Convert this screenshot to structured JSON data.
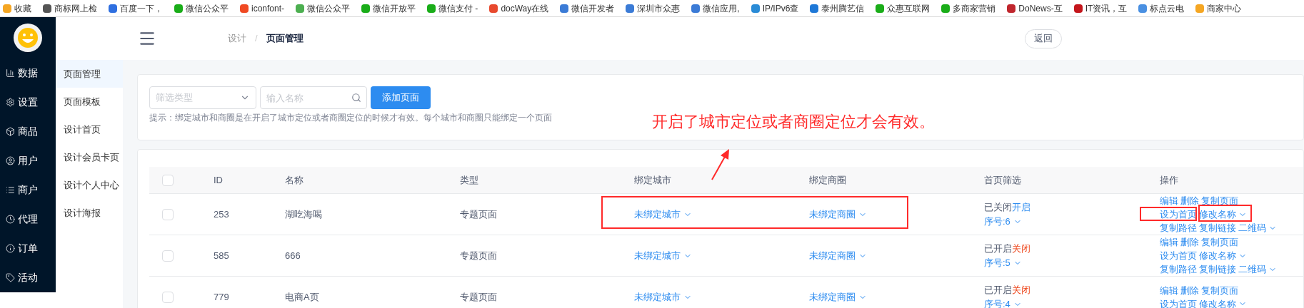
{
  "bookmarks": [
    {
      "label": "收藏",
      "color": "#f5a623"
    },
    {
      "label": "商标网上检",
      "color": "#555555"
    },
    {
      "label": "百度一下，",
      "color": "#2f6fe0"
    },
    {
      "label": "微信公众平",
      "color": "#1aad19"
    },
    {
      "label": "iconfont-",
      "color": "#f04a23"
    },
    {
      "label": "微信公众平",
      "color": "#4caf50"
    },
    {
      "label": "微信开放平",
      "color": "#1aad19"
    },
    {
      "label": "微信支付 -",
      "color": "#1aad19"
    },
    {
      "label": "docWay在线",
      "color": "#e8492e"
    },
    {
      "label": "微信开发者",
      "color": "#3b7bd6"
    },
    {
      "label": "深圳市众惠",
      "color": "#3b7bd6"
    },
    {
      "label": "微信应用,",
      "color": "#3b7bd6"
    },
    {
      "label": "IP/IPv6查",
      "color": "#2a8bd6"
    },
    {
      "label": "泰州腾艺信",
      "color": "#1e78d7"
    },
    {
      "label": "众惠互联网",
      "color": "#1aad19"
    },
    {
      "label": "多商家营销",
      "color": "#1aad19"
    },
    {
      "label": "DoNews-互",
      "color": "#c0262d"
    },
    {
      "label": "IT资讯，互",
      "color": "#c4161c"
    },
    {
      "label": "标点云电",
      "color": "#4a90e2"
    },
    {
      "label": "商家中心",
      "color": "#f5a623"
    }
  ],
  "nav": [
    {
      "label": "数据",
      "selected": false
    },
    {
      "label": "设置",
      "selected": false
    },
    {
      "label": "商品",
      "selected": false
    },
    {
      "label": "用户",
      "selected": false
    },
    {
      "label": "商户",
      "selected": false
    },
    {
      "label": "代理",
      "selected": false
    },
    {
      "label": "订单",
      "selected": false
    },
    {
      "label": "活动",
      "selected": false
    }
  ],
  "submenu": [
    {
      "label": "页面管理",
      "selected": true
    },
    {
      "label": "页面模板",
      "selected": false
    },
    {
      "label": "设计首页",
      "selected": false
    },
    {
      "label": "设计会员卡页",
      "selected": false
    },
    {
      "label": "设计个人中心",
      "selected": false
    },
    {
      "label": "设计海报",
      "selected": false
    }
  ],
  "breadcrumb": [
    "设计",
    "页面管理"
  ],
  "breadcrumb_separator": "/",
  "back_button": "返回",
  "filter": {
    "type_placeholder": "筛选类型",
    "name_placeholder": "输入名称",
    "add_button": "添加页面",
    "hint": "提示：绑定城市和商圈是在开启了城市定位或者商圈定位的时候才有效。每个城市和商圈只能绑定一个页面"
  },
  "annotation": {
    "text": "开启了城市定位或者商圈定位才会有效。"
  },
  "table": {
    "columns": [
      "ID",
      "名称",
      "类型",
      "绑定城市",
      "绑定商圈",
      "首页筛选",
      "操作"
    ],
    "header_checked": false,
    "rows": [
      {
        "checked": false,
        "id": "253",
        "name": "湖吃海喝",
        "type": "专题页面",
        "city": "未绑定城市",
        "area": "未绑定商圈",
        "status": "已关闭",
        "toggle": "开启",
        "enabled": false,
        "order": "序号:6",
        "actions": [
          [
            "编辑",
            "删除",
            "复制页面"
          ],
          [
            "设为首页",
            "修改名称"
          ],
          [
            "复制路径",
            "复制链接",
            "二维码"
          ]
        ]
      },
      {
        "checked": false,
        "id": "585",
        "name": "666",
        "type": "专题页面",
        "city": "未绑定城市",
        "area": "未绑定商圈",
        "status": "已开启",
        "toggle": "关闭",
        "enabled": true,
        "order": "序号:5",
        "actions": [
          [
            "编辑",
            "删除",
            "复制页面"
          ],
          [
            "设为首页",
            "修改名称"
          ],
          [
            "复制路径",
            "复制链接",
            "二维码"
          ]
        ]
      },
      {
        "checked": false,
        "id": "779",
        "name": "电商A页",
        "type": "专题页面",
        "city": "未绑定城市",
        "area": "未绑定商圈",
        "status": "已开启",
        "toggle": "关闭",
        "enabled": true,
        "order": "序号:4",
        "actions": [
          [
            "编辑",
            "删除",
            "复制页面"
          ],
          [
            "设为首页",
            "修改名称"
          ]
        ]
      }
    ]
  }
}
